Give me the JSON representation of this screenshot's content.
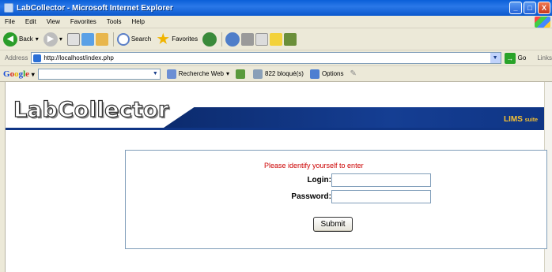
{
  "window": {
    "title": "LabCollector - Microsoft Internet Explorer",
    "minimize": "_",
    "maximize": "□",
    "close": "X"
  },
  "menu": {
    "items": [
      "File",
      "Edit",
      "View",
      "Favorites",
      "Tools",
      "Help"
    ]
  },
  "toolbar": {
    "back": "Back",
    "search": "Search",
    "favorites": "Favorites"
  },
  "address": {
    "label": "Address",
    "url": "http://localhost/index.php",
    "go": "Go",
    "links": "Links"
  },
  "googlebar": {
    "logo": {
      "g1": "G",
      "o1": "o",
      "o2": "o",
      "g2": "g",
      "l": "l",
      "e": "e",
      "arrow": "▾"
    },
    "web_search": "Recherche Web",
    "blocked": "822 bloqué(s)",
    "options": "Options"
  },
  "banner": {
    "logo_text": "LabCollector",
    "product": "LIMS",
    "product_suffix": "suite"
  },
  "login": {
    "prompt": "Please identify yourself to enter",
    "login_label": "Login:",
    "password_label": "Password:",
    "login_value": "",
    "password_value": "",
    "submit_label": "Submit"
  },
  "colors": {
    "prompt": "#cc0000",
    "banner": "#0f3585",
    "lims": "#f7c233"
  }
}
